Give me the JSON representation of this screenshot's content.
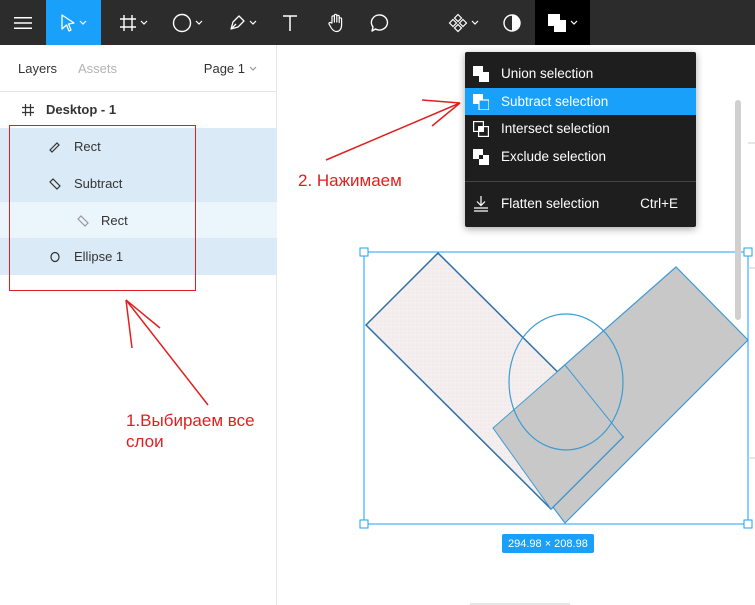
{
  "toolbar": {
    "tools": [
      {
        "name": "menu",
        "icon": "hamburger-icon"
      },
      {
        "name": "move",
        "icon": "move-cursor-icon",
        "active": true
      },
      {
        "name": "frame",
        "icon": "frame-grid-icon"
      },
      {
        "name": "ellipse",
        "icon": "ellipse-icon"
      },
      {
        "name": "pen",
        "icon": "pen-icon"
      },
      {
        "name": "text",
        "icon": "text-icon"
      },
      {
        "name": "hand",
        "icon": "hand-icon"
      },
      {
        "name": "comment",
        "icon": "comment-icon"
      },
      {
        "name": "component",
        "icon": "component-icon"
      },
      {
        "name": "mask",
        "icon": "mask-icon"
      },
      {
        "name": "boolean",
        "icon": "boolean-union-icon",
        "active": true
      }
    ]
  },
  "left_panel": {
    "tabs": {
      "layers": "Layers",
      "assets": "Assets"
    },
    "page": "Page 1",
    "layers": [
      {
        "label": "Desktop - 1",
        "icon": "frame-hash-icon",
        "bold": true
      },
      {
        "label": "Rect",
        "icon": "rect-rotated-icon",
        "selected": true
      },
      {
        "label": "Subtract",
        "icon": "subtract-rotated-icon",
        "selected": true
      },
      {
        "label": "Rect",
        "icon": "rect-rotated-icon",
        "selected": "child"
      },
      {
        "label": "Ellipse 1",
        "icon": "ellipse-small-icon",
        "selected": true
      }
    ]
  },
  "menu": {
    "items": [
      {
        "label": "Union selection",
        "icon": "union-icon"
      },
      {
        "label": "Subtract selection",
        "icon": "subtract-icon",
        "highlighted": true
      },
      {
        "label": "Intersect selection",
        "icon": "intersect-icon"
      },
      {
        "label": "Exclude selection",
        "icon": "exclude-icon"
      },
      {
        "label": "Flatten selection",
        "icon": "flatten-icon",
        "shortcut": "Ctrl+E"
      }
    ]
  },
  "annotations": {
    "step1": "1.Выбираем все слои",
    "step2": "2. Нажимаем"
  },
  "canvas": {
    "dimensions": "294.98 × 208.98"
  },
  "colors": {
    "toolbar_bg": "#2c2c2c",
    "accent": "#18a0fb",
    "annotation_red": "#e02020",
    "selected_layer": "#daebf7"
  }
}
